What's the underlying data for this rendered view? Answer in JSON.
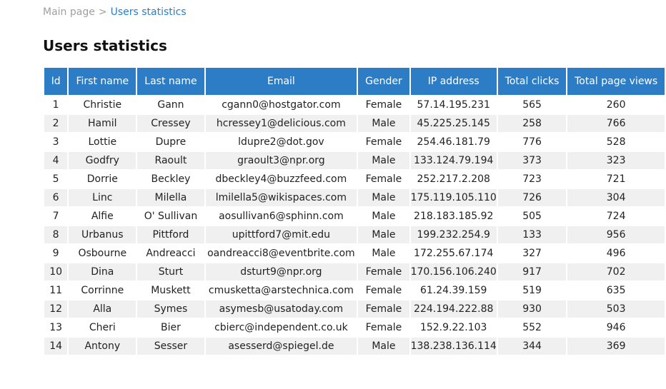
{
  "breadcrumb": {
    "home": "Main page",
    "separator": ">",
    "current": "Users statistics"
  },
  "title": "Users statistics",
  "table": {
    "headers": [
      "Id",
      "First name",
      "Last name",
      "Email",
      "Gender",
      "IP address",
      "Total clicks",
      "Total page views"
    ],
    "rows": [
      [
        "1",
        "Christie",
        "Gann",
        "cgann0@hostgator.com",
        "Female",
        "57.14.195.231",
        "565",
        "260"
      ],
      [
        "2",
        "Hamil",
        "Cressey",
        "hcressey1@delicious.com",
        "Male",
        "45.225.25.145",
        "258",
        "766"
      ],
      [
        "3",
        "Lottie",
        "Dupre",
        "ldupre2@dot.gov",
        "Female",
        "254.46.181.79",
        "776",
        "528"
      ],
      [
        "4",
        "Godfry",
        "Raoult",
        "graoult3@npr.org",
        "Male",
        "133.124.79.194",
        "373",
        "323"
      ],
      [
        "5",
        "Dorrie",
        "Beckley",
        "dbeckley4@buzzfeed.com",
        "Female",
        "252.217.2.208",
        "723",
        "721"
      ],
      [
        "6",
        "Linc",
        "Milella",
        "lmilella5@wikispaces.com",
        "Male",
        "175.119.105.110",
        "726",
        "304"
      ],
      [
        "7",
        "Alfie",
        "O' Sullivan",
        "aosullivan6@sphinn.com",
        "Male",
        "218.183.185.92",
        "505",
        "724"
      ],
      [
        "8",
        "Urbanus",
        "Pittford",
        "upittford7@mit.edu",
        "Male",
        "199.232.254.9",
        "133",
        "956"
      ],
      [
        "9",
        "Osbourne",
        "Andreacci",
        "oandreacci8@eventbrite.com",
        "Male",
        "172.255.67.174",
        "327",
        "496"
      ],
      [
        "10",
        "Dina",
        "Sturt",
        "dsturt9@npr.org",
        "Female",
        "170.156.106.240",
        "917",
        "702"
      ],
      [
        "11",
        "Corrinne",
        "Muskett",
        "cmusketta@arstechnica.com",
        "Female",
        "61.24.39.159",
        "519",
        "635"
      ],
      [
        "12",
        "Alla",
        "Symes",
        "asymesb@usatoday.com",
        "Female",
        "224.194.222.88",
        "930",
        "503"
      ],
      [
        "13",
        "Cheri",
        "Bier",
        "cbierc@independent.co.uk",
        "Female",
        "152.9.22.103",
        "552",
        "946"
      ],
      [
        "14",
        "Antony",
        "Sesser",
        "asesserd@spiegel.de",
        "Male",
        "138.238.136.114",
        "344",
        "369"
      ]
    ]
  },
  "colors": {
    "accent": "#2d7dc6",
    "header_text": "#ffffff",
    "row_alt": "#f0f0f0",
    "breadcrumb_muted": "#a0a0a0"
  }
}
